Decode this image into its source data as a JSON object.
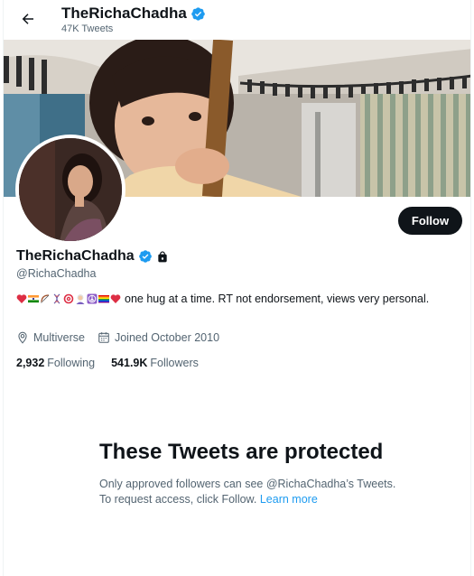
{
  "header": {
    "title": "TheRichaChadha",
    "tweet_count": "47K Tweets"
  },
  "profile": {
    "display_name": "TheRichaChadha",
    "handle": "@RichaChadha",
    "follow_label": "Follow",
    "bio_text": "one hug at a time. RT not endorsement, views very personal.",
    "bio_emojis": [
      "red-heart",
      "india-flag",
      "archery",
      "dna",
      "target",
      "person-white-hair",
      "peace-symbol",
      "rainbow-flag",
      "red-heart"
    ],
    "location": "Multiverse",
    "joined": "Joined October 2010",
    "following_count": "2,932",
    "following_label": "Following",
    "followers_count": "541.9K",
    "followers_label": "Followers"
  },
  "protected": {
    "title": "These Tweets are protected",
    "text": "Only approved followers can see @RichaChadha’s Tweets. To request access, click Follow.",
    "link": "Learn more"
  },
  "colors": {
    "verified": "#1d9bf0",
    "link": "#1d9bf0",
    "button": "#0f1419",
    "secondary_text": "#536471"
  }
}
